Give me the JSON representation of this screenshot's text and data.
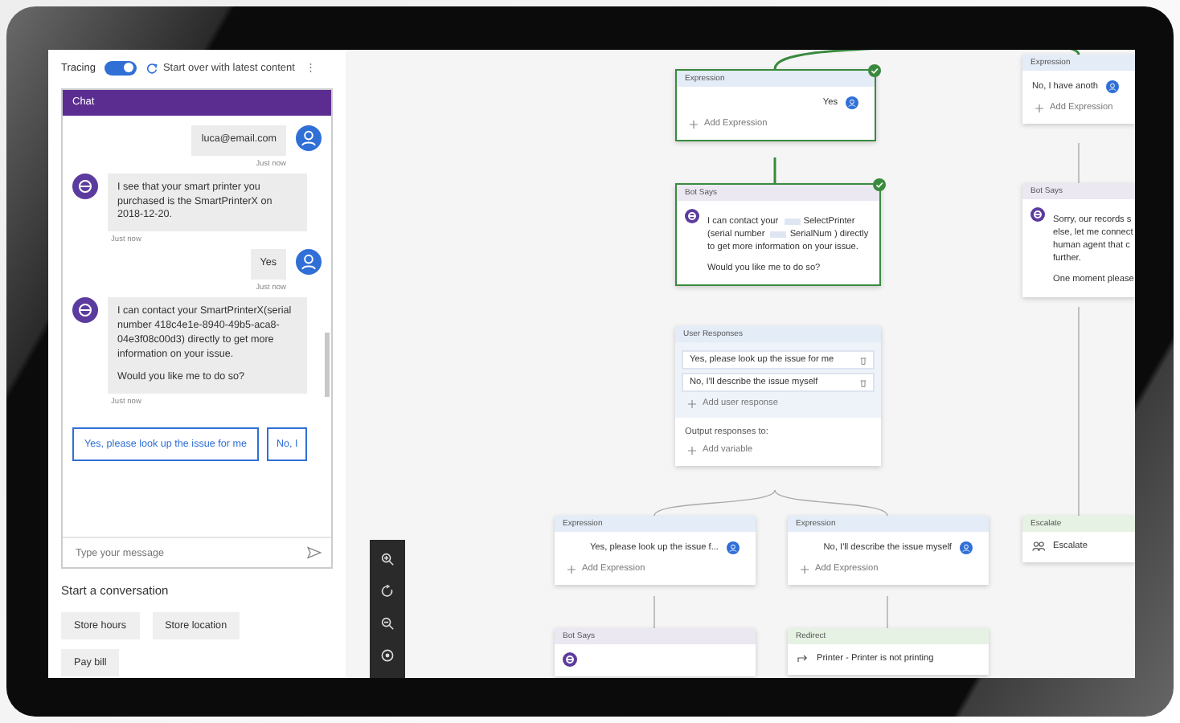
{
  "toolbar": {
    "tracing_label": "Tracing",
    "tracing_on": true,
    "start_over": "Start over with latest content",
    "more": "⋮"
  },
  "chat": {
    "title": "Chat",
    "messages": [
      {
        "kind": "user",
        "paragraphs": [
          "luca@email.com"
        ],
        "time": "Just now"
      },
      {
        "kind": "bot",
        "paragraphs": [
          "I see that your smart printer you purchased is the SmartPrinterX on 2018-12-20."
        ],
        "time": "Just now"
      },
      {
        "kind": "user",
        "paragraphs": [
          "Yes"
        ],
        "time": "Just now"
      },
      {
        "kind": "bot",
        "paragraphs": [
          "I can contact your SmartPrinterX(serial number 418c4e1e-8940-49b5-aca8-04e3f08c00d3) directly to get more information on your issue.",
          "Would you like me to do so?"
        ],
        "time": "Just now"
      }
    ],
    "suggestions": [
      "Yes, please look up the issue for me",
      "No, I"
    ],
    "input": {
      "placeholder": "Type your message"
    }
  },
  "start_conversation": {
    "title": "Start a conversation",
    "topics": [
      "Store hours",
      "Store location",
      "Pay bill"
    ]
  },
  "canvas": {
    "nodes": [
      {
        "kind": "expression",
        "header": "Expression",
        "highlighted": false,
        "value": "No, I have anoth",
        "add": "Add Expression"
      },
      {
        "kind": "expression",
        "header": "Expression",
        "highlighted": true,
        "value": "Yes",
        "add": "Add Expression"
      },
      {
        "kind": "bot_says",
        "header": "Bot Says",
        "highlighted": true,
        "paragraphs": [
          [
            {
              "kind": "text",
              "text": "I can contact your"
            },
            {
              "kind": "variable",
              "text": "SelectPrinter"
            },
            {
              "kind": "text",
              "text": "(serial number"
            },
            {
              "kind": "variable",
              "text": "SerialNum"
            },
            {
              "kind": "text",
              "text": ") directly to get more information on your issue."
            }
          ],
          [
            {
              "kind": "text",
              "text": "Would you like me to do so?"
            }
          ]
        ]
      },
      {
        "kind": "bot_says",
        "header": "Bot Says",
        "highlighted": false,
        "paragraphs": [
          [
            {
              "kind": "line",
              "text": "Sorry, our records s"
            },
            {
              "kind": "line",
              "text": "else, let me connect"
            },
            {
              "kind": "line",
              "text": "human agent that c"
            },
            {
              "kind": "line",
              "text": "further."
            }
          ],
          [
            {
              "kind": "line",
              "text": "One moment please"
            }
          ]
        ]
      },
      {
        "kind": "user_responses",
        "header": "User Responses",
        "highlighted": false,
        "responses": [
          "Yes, please look up the issue for me",
          "No, I'll describe the issue myself"
        ],
        "add": "Add user response",
        "output_label": "Output responses to:",
        "add_variable": "Add variable"
      },
      {
        "kind": "expression",
        "header": "Expression",
        "highlighted": false,
        "value": "Yes, please look up the issue f...",
        "add": "Add Expression"
      },
      {
        "kind": "expression",
        "header": "Expression",
        "highlighted": false,
        "value": "No, I'll describe the issue myself",
        "add": "Add Expression"
      },
      {
        "kind": "escalate",
        "header": "Escalate",
        "highlighted": false,
        "label": "Escalate"
      },
      {
        "kind": "bot_says",
        "header": "Bot Says",
        "highlighted": false
      },
      {
        "kind": "redirect",
        "header": "Redirect",
        "highlighted": false,
        "label": "Printer - Printer is not printing"
      }
    ]
  }
}
